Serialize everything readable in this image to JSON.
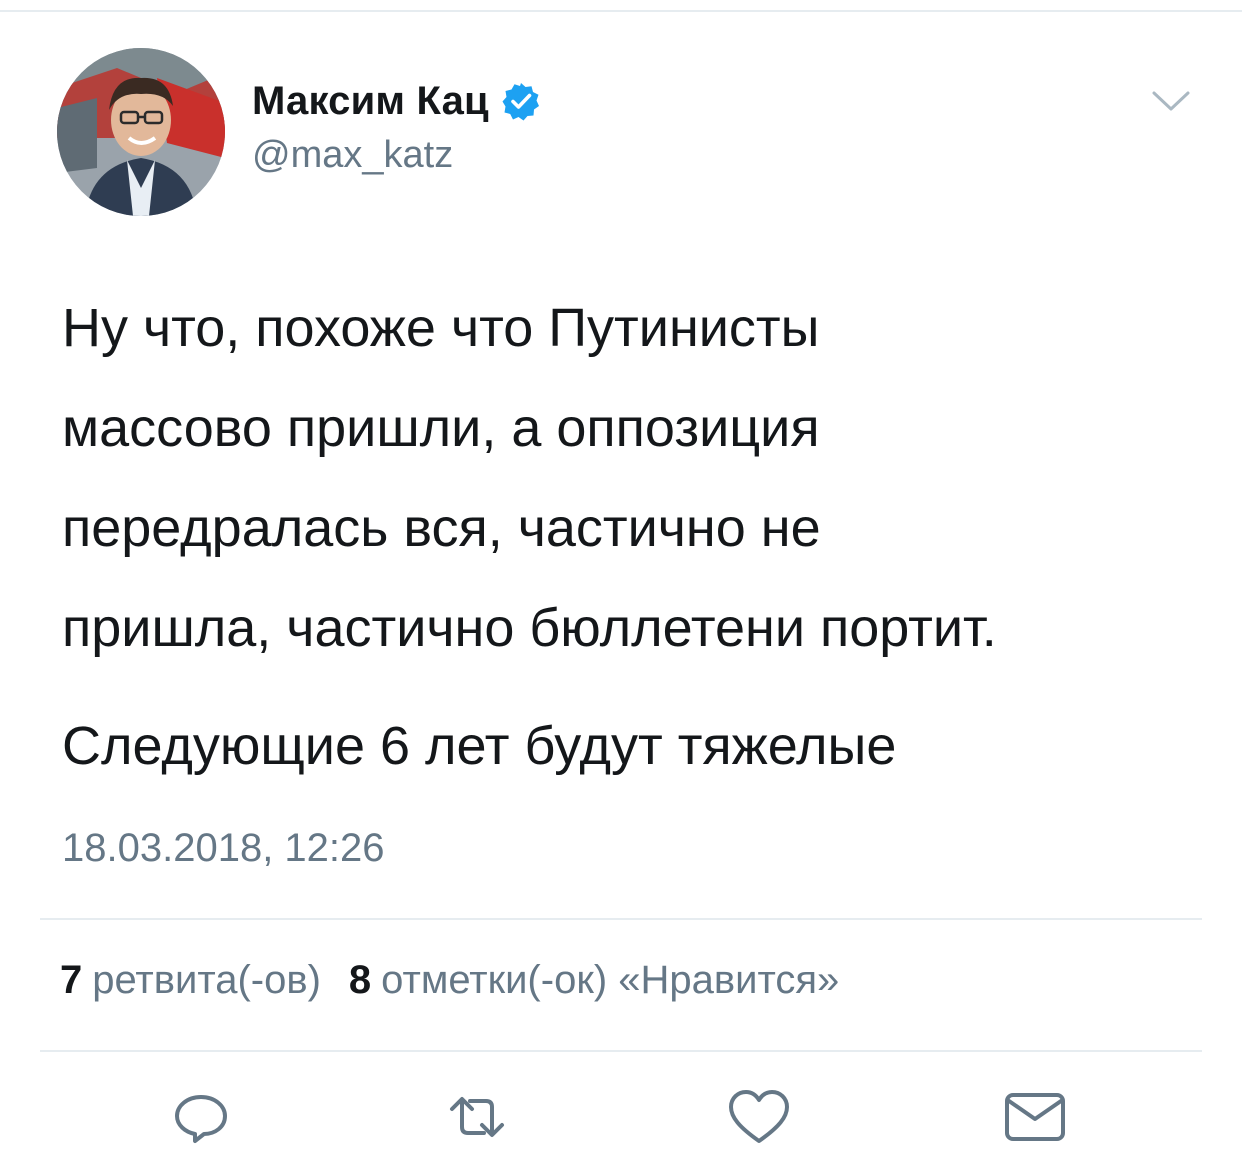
{
  "author": {
    "display_name": "Максим Кац",
    "handle": "@max_katz",
    "verified": true,
    "avatar_icon": "profile-photo"
  },
  "tweet": {
    "paragraphs": [
      [
        "Ну что, похоже что Путинисты",
        "массово пришли, а оппозиция",
        "передралась вся, частично не",
        "пришла, частично бюллетени портит."
      ],
      [
        "Следующие 6 лет будут тяжелые"
      ]
    ],
    "timestamp": "18.03.2018, 12:26"
  },
  "stats": {
    "retweets_count": "7",
    "retweets_label": "ретвита(-ов)",
    "likes_count": "8",
    "likes_label": "отметки(-ок) «Нравится»"
  },
  "actions": [
    {
      "name": "reply",
      "icon": "reply-icon"
    },
    {
      "name": "retweet",
      "icon": "retweet-icon"
    },
    {
      "name": "like",
      "icon": "heart-icon"
    },
    {
      "name": "direct-message",
      "icon": "envelope-icon"
    }
  ],
  "colors": {
    "text_primary": "#14171a",
    "text_secondary": "#657786",
    "verified_blue": "#1da1f2",
    "icon_gray": "#657786",
    "divider": "#e6ecf0"
  }
}
